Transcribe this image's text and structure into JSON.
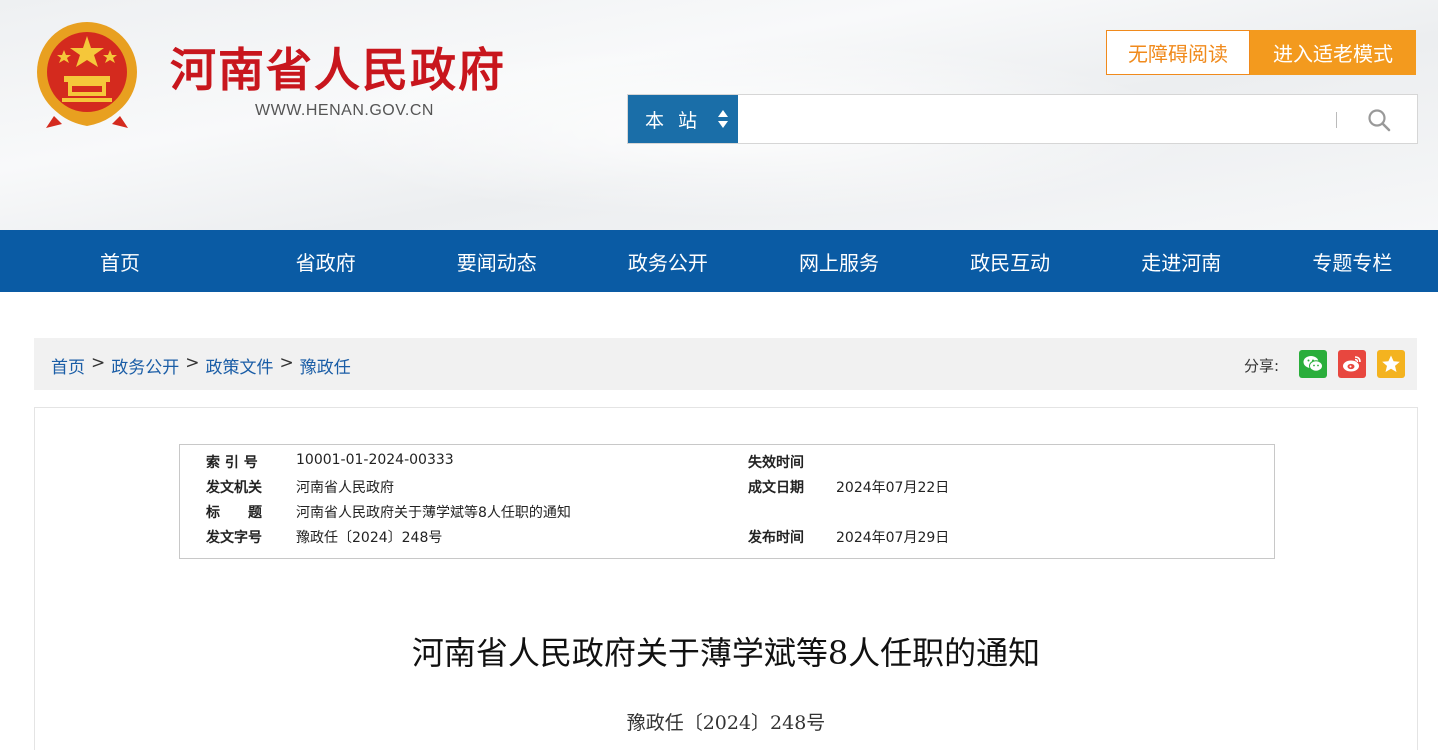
{
  "header": {
    "site_name": "河南省人民政府",
    "site_url": "WWW.HENAN.GOV.CN",
    "accessible_label": "无障碍阅读",
    "elder_mode_label": "进入适老模式"
  },
  "search": {
    "scope_label": "本站",
    "value": "",
    "placeholder": ""
  },
  "nav": {
    "items": [
      {
        "label": "首页"
      },
      {
        "label": "省政府"
      },
      {
        "label": "要闻动态"
      },
      {
        "label": "政务公开"
      },
      {
        "label": "网上服务"
      },
      {
        "label": "政民互动"
      },
      {
        "label": "走进河南"
      },
      {
        "label": "专题专栏"
      }
    ]
  },
  "breadcrumb": {
    "items": [
      "首页",
      "政务公开",
      "政策文件",
      "豫政任"
    ],
    "separator": ">"
  },
  "share": {
    "label": "分享:"
  },
  "meta": {
    "index_label": "索 引 号",
    "index_value": "10001-01-2024-00333",
    "expire_label": "失效时间",
    "expire_value": "",
    "issuer_label": "发文机关",
    "issuer_value": "河南省人民政府",
    "created_label": "成文日期",
    "created_value": "2024年07月22日",
    "title_label": "标　　题",
    "title_value": "河南省人民政府关于薄学斌等8人任职的通知",
    "docno_label": "发文字号",
    "docno_value": "豫政任〔2024〕248号",
    "published_label": "发布时间",
    "published_value": "2024年07月29日"
  },
  "document": {
    "title": "河南省人民政府关于薄学斌等8人任职的通知",
    "number": "豫政任〔2024〕248号"
  },
  "colors": {
    "brand_red": "#c8161d",
    "nav_blue": "#0a5ba4",
    "accent_orange": "#f39a1e",
    "scope_blue": "#1a6ea8"
  }
}
